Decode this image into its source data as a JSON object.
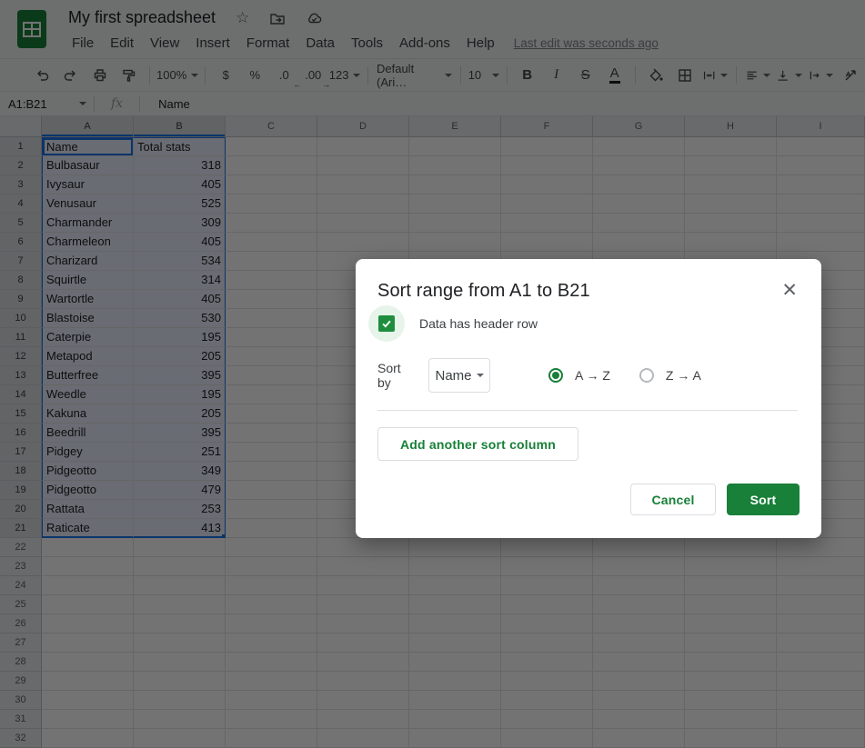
{
  "header": {
    "title": "My first spreadsheet",
    "menu_items": [
      "File",
      "Edit",
      "View",
      "Insert",
      "Format",
      "Data",
      "Tools",
      "Add-ons",
      "Help"
    ],
    "last_edit": "Last edit was seconds ago"
  },
  "toolbar": {
    "zoom": "100%",
    "format_currency": "$",
    "format_percent": "%",
    "decrease_decimal": ".0",
    "increase_decimal": ".00",
    "more_formats": "123",
    "font_family": "Default (Ari…",
    "font_size": "10",
    "bold": "B",
    "italic": "I",
    "strikethrough": "S",
    "text_color": "A"
  },
  "formula_bar": {
    "name_box": "A1:B21",
    "fx": "fx",
    "content": "Name"
  },
  "grid": {
    "column_headers": [
      "A",
      "B",
      "C",
      "D",
      "E",
      "F",
      "G",
      "H",
      "I"
    ],
    "selected_columns": [
      "A",
      "B"
    ],
    "selection": {
      "range": "A1:B21",
      "active_cell": "A1"
    },
    "total_rows": 32,
    "rows": [
      [
        "Name",
        "Total stats"
      ],
      [
        "Bulbasaur",
        "318"
      ],
      [
        "Ivysaur",
        "405"
      ],
      [
        "Venusaur",
        "525"
      ],
      [
        "Charmander",
        "309"
      ],
      [
        "Charmeleon",
        "405"
      ],
      [
        "Charizard",
        "534"
      ],
      [
        "Squirtle",
        "314"
      ],
      [
        "Wartortle",
        "405"
      ],
      [
        "Blastoise",
        "530"
      ],
      [
        "Caterpie",
        "195"
      ],
      [
        "Metapod",
        "205"
      ],
      [
        "Butterfree",
        "395"
      ],
      [
        "Weedle",
        "195"
      ],
      [
        "Kakuna",
        "205"
      ],
      [
        "Beedrill",
        "395"
      ],
      [
        "Pidgey",
        "251"
      ],
      [
        "Pidgeotto",
        "349"
      ],
      [
        "Pidgeotto",
        "479"
      ],
      [
        "Rattata",
        "253"
      ],
      [
        "Raticate",
        "413"
      ]
    ]
  },
  "dialog": {
    "title": "Sort range from A1 to B21",
    "close": "✕",
    "header_checkbox_label": "Data has header row",
    "header_checkbox_checked": true,
    "sort_by_label": "Sort by",
    "sort_column": "Name",
    "radio_az": "A → Z",
    "radio_za": "Z → A",
    "radio_selected": "A → Z",
    "add_column_label": "Add another sort column",
    "cancel_label": "Cancel",
    "sort_label": "Sort"
  },
  "colors": {
    "green": "#188038",
    "checkbox_green": "#1e8e3e",
    "blue": "#1a73e8",
    "selection_tint": "#e8f0fe",
    "chrome_bg": "#f1f3f4",
    "header_gray": "#e8eaed",
    "text_primary": "#202124",
    "text_secondary": "#5f6368",
    "icon_gray": "#444746"
  }
}
